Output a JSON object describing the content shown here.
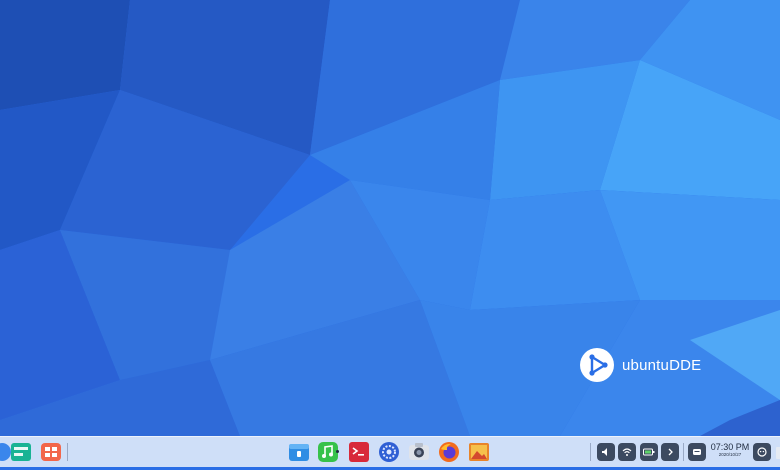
{
  "desktop": {
    "brand": {
      "name": "ubuntuDDE",
      "logo_icon": "ubuntudde-logo-icon"
    },
    "wallpaper": {
      "style": "low-poly blue",
      "colors": [
        "#1a4fb8",
        "#2a6ee6",
        "#3a8ff2",
        "#4aa8f8"
      ]
    }
  },
  "dock": {
    "left_items": [
      {
        "id": "launcher",
        "icon": "launcher-icon"
      },
      {
        "id": "multitask",
        "icon": "multitasking-view-icon"
      },
      {
        "id": "show-desktop",
        "icon": "show-desktop-icon"
      }
    ],
    "apps": [
      {
        "id": "file-manager",
        "icon": "file-manager-icon",
        "color": "#2f8de4"
      },
      {
        "id": "music",
        "icon": "music-icon",
        "color": "#37c24a"
      },
      {
        "id": "terminal",
        "icon": "terminal-icon",
        "color": "#d8293a"
      },
      {
        "id": "control-center",
        "icon": "control-center-icon",
        "color": "#2f5fd4"
      },
      {
        "id": "screenshot",
        "icon": "camera-icon",
        "color": "#8a96ac"
      },
      {
        "id": "firefox",
        "icon": "firefox-icon",
        "color": "#f26b1d"
      },
      {
        "id": "image-viewer",
        "icon": "image-viewer-icon",
        "color": "#e8842a"
      }
    ],
    "tray": [
      {
        "id": "volume",
        "icon": "volume-icon"
      },
      {
        "id": "wifi",
        "icon": "wifi-icon"
      },
      {
        "id": "battery",
        "icon": "battery-icon"
      },
      {
        "id": "expand",
        "icon": "chevron-right-icon"
      },
      {
        "id": "notifications",
        "icon": "notification-icon"
      }
    ],
    "clock": {
      "time": "07:30 PM",
      "date": "2020/10/27"
    },
    "power": {
      "icon": "power-icon"
    }
  }
}
